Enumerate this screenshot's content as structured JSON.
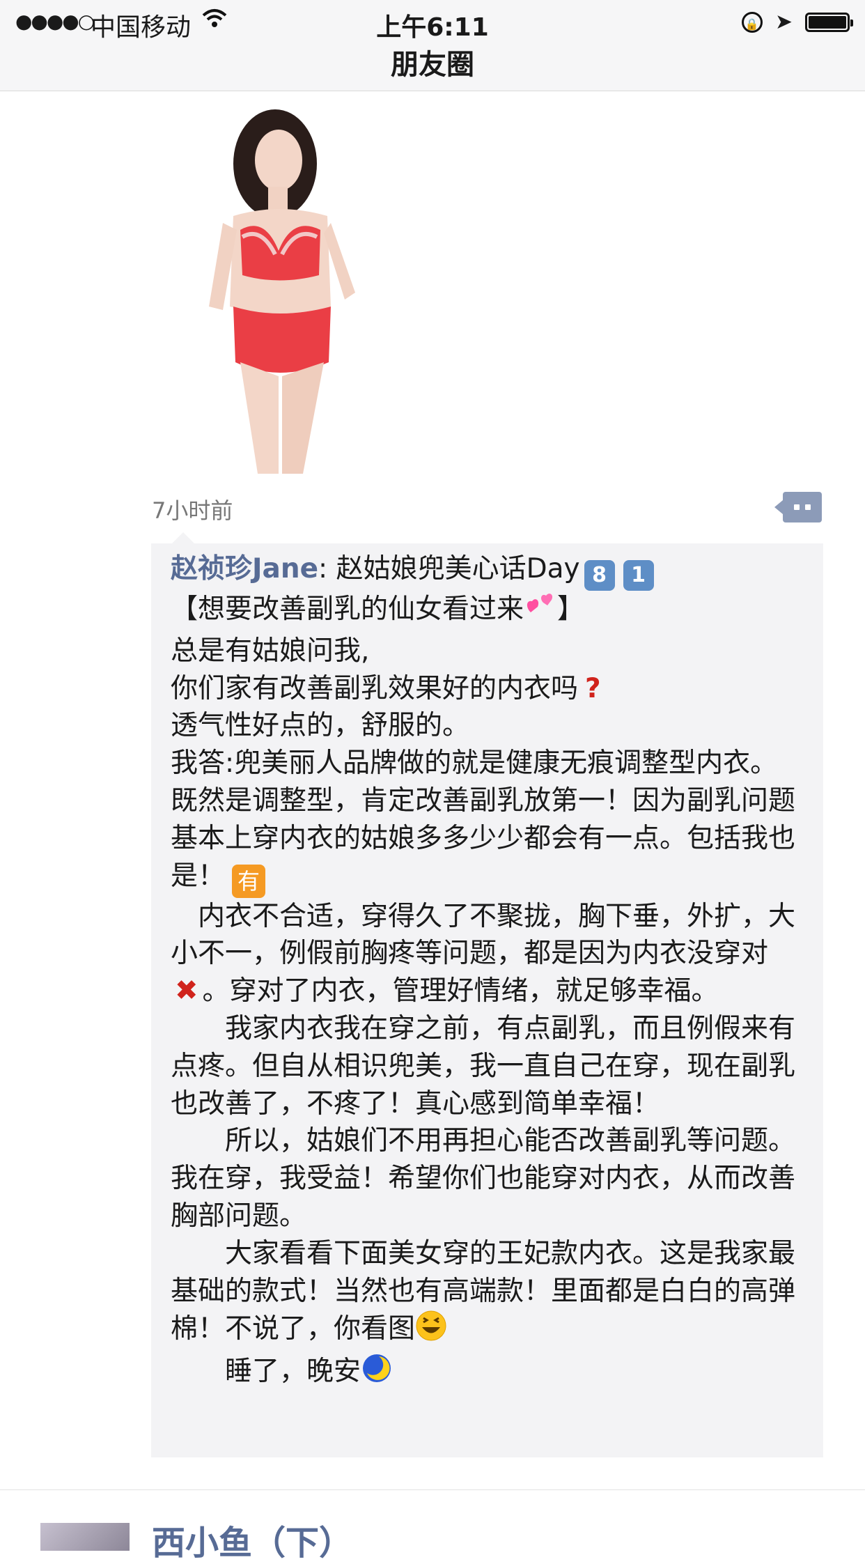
{
  "status_bar": {
    "signal": "●●●●○",
    "carrier": "中国移动",
    "time": "上午6:11"
  },
  "nav": {
    "title": "朋友圈"
  },
  "post": {
    "timestamp": "7小时前"
  },
  "comment": {
    "author": "赵祯珍Jane",
    "colon": ": ",
    "intro": "赵姑娘兜美心话Day",
    "day_digit_1": "8",
    "day_digit_2": "1",
    "line_title_open": "【想要改善副乳的仙女看过来",
    "line_title_close": "】",
    "line_1": "总是有姑娘问我,",
    "line_2": "你们家有改善副乳效果好的内衣吗",
    "line_3": "透气性好点的，舒服的。",
    "para_1": "我答:兜美丽人品牌做的就是健康无痕调整型内衣。既然是调整型，肯定改善副乳放第一！因为副乳问题基本上穿内衣的姑娘多多少少都会有一点。包括我也是！",
    "you_badge": "有",
    "para_2a": "　内衣不合适，穿得久了不聚拢，胸下垂，外扩，大小不一，例假前胸疼等问题，都是因为内衣没穿对",
    "para_2b": "。穿对了内衣，管理好情绪，就足够幸福。",
    "para_3": "　　我家内衣我在穿之前，有点副乳，而且例假来有点疼。但自从相识兜美，我一直自己在穿，现在副乳也改善了，不疼了！真心感到简单幸福！",
    "para_4": "　　所以，姑娘们不用再担心能否改善副乳等问题。我在穿，我受益！希望你们也能穿对内衣，从而改善胸部问题。",
    "para_5": "　　大家看看下面美女穿的王妃款内衣。这是我家最基础的款式！当然也有高端款！里面都是白白的高弹棉！不说了，你看图",
    "para_6": "　　睡了，晚安"
  },
  "next_post": {
    "name": "西小鱼（下）"
  },
  "colors": {
    "link_blue": "#576b95",
    "comment_bg": "#f3f3f5",
    "status_bg": "#f6f6f7"
  }
}
